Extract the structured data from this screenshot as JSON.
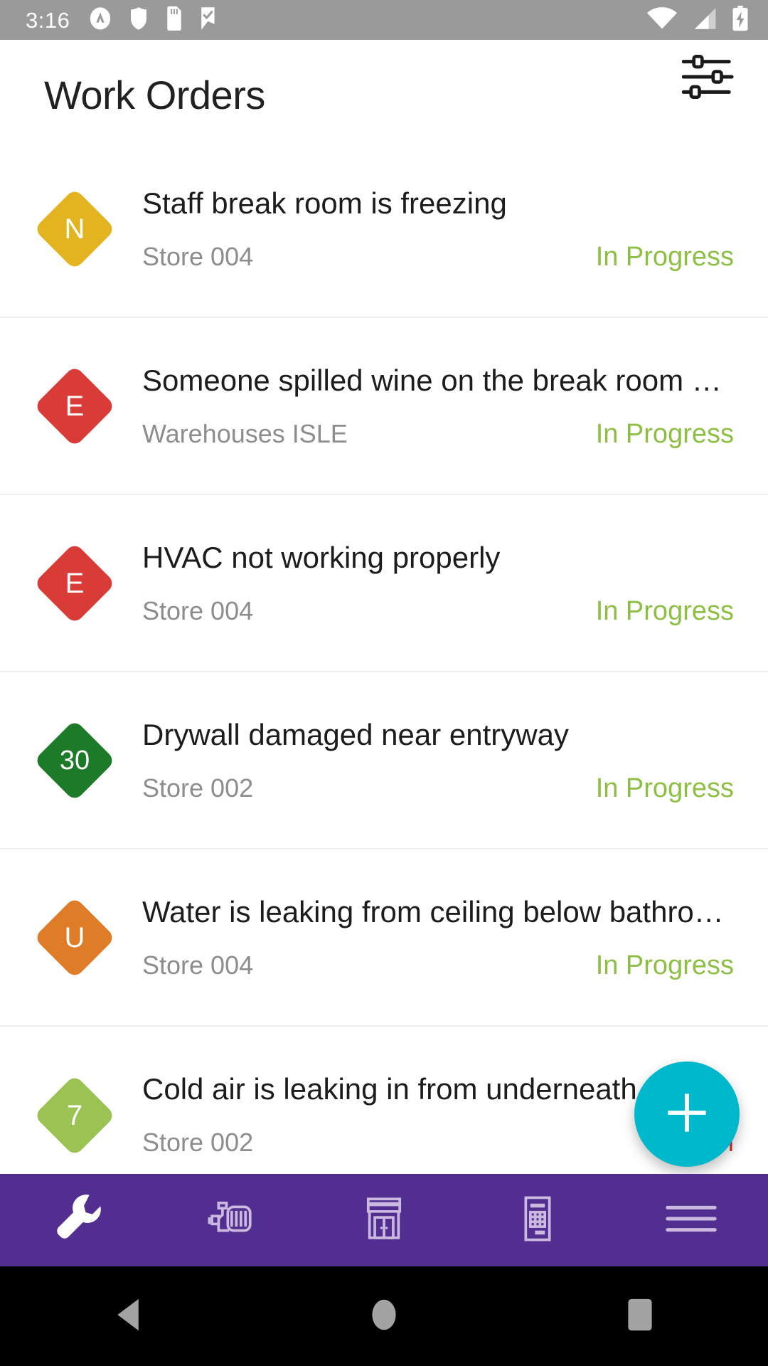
{
  "status_bar": {
    "time": "3:16",
    "left_icons": [
      "app-badge-icon",
      "shield-icon",
      "sd-card-icon",
      "check-flag-icon"
    ],
    "right_icons": [
      "wifi-icon",
      "cell-signal-icon",
      "battery-charging-icon"
    ],
    "background_color": "#9a9a9a"
  },
  "app_bar": {
    "title": "Work Orders",
    "filter_icon": "sliders-filter-icon"
  },
  "colors": {
    "accent_fab": "#00B8CC",
    "nav_background": "#512e90",
    "status_in_progress": "#8DBF45",
    "status_open": "#D0342C",
    "divider": "#eeeeee",
    "title_text": "#1c1c1c",
    "subtitle_text": "#8d8d8d"
  },
  "work_orders": [
    {
      "badge_label": "N",
      "badge_color": "#E3B420",
      "title": "Staff break room is freezing",
      "location": "Store 004",
      "status": "In Progress",
      "status_color": "#8DBF45"
    },
    {
      "badge_label": "E",
      "badge_color": "#D93B36",
      "title": "Someone spilled wine on the break room …",
      "location": "Warehouses ISLE",
      "status": "In Progress",
      "status_color": "#8DBF45"
    },
    {
      "badge_label": "E",
      "badge_color": "#D93B36",
      "title": "HVAC not working properly",
      "location": "Store 004",
      "status": "In Progress",
      "status_color": "#8DBF45"
    },
    {
      "badge_label": "30",
      "badge_color": "#1D7A29",
      "title": "Drywall damaged near entryway",
      "location": "Store 002",
      "status": "In Progress",
      "status_color": "#8DBF45"
    },
    {
      "badge_label": "U",
      "badge_color": "#DE7C28",
      "title": "Water is leaking from ceiling below bathro…",
      "location": "Store 004",
      "status": "In Progress",
      "status_color": "#8DBF45"
    },
    {
      "badge_label": "7",
      "badge_color": "#9BC353",
      "title": "Cold air is leaking in from underneath",
      "location": "Store 002",
      "status": "Open",
      "status_color": "#D0342C"
    }
  ],
  "fab": {
    "icon": "plus-icon",
    "label": "+"
  },
  "bottom_nav": {
    "items": [
      {
        "icon": "wrench-icon",
        "active": true
      },
      {
        "icon": "motor-pump-icon",
        "active": false
      },
      {
        "icon": "store-front-icon",
        "active": false
      },
      {
        "icon": "report-document-icon",
        "active": false
      },
      {
        "icon": "hamburger-menu-icon",
        "active": false
      }
    ]
  },
  "system_nav": {
    "items": [
      "back-icon",
      "home-icon",
      "recents-icon"
    ]
  }
}
